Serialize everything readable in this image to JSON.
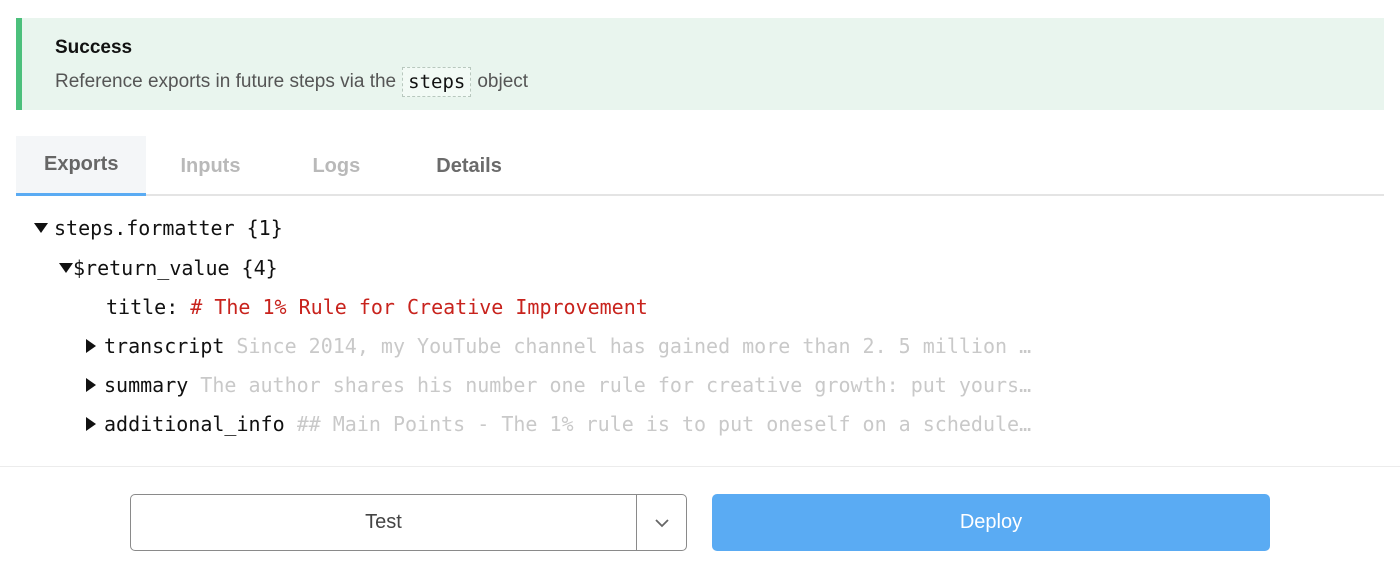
{
  "banner": {
    "title": "Success",
    "message_before": "Reference exports in future steps via the",
    "code": "steps",
    "message_after": "object",
    "accent_color": "#4cc07c",
    "background_color": "#e9f5ee"
  },
  "tabs": [
    {
      "label": "Exports",
      "active": true
    },
    {
      "label": "Inputs",
      "active": false
    },
    {
      "label": "Logs",
      "active": false
    },
    {
      "label": "Details",
      "active": false
    }
  ],
  "tree": {
    "root": {
      "key": "steps.formatter",
      "count": "{1}",
      "expanded": true
    },
    "return_value": {
      "key": "$return_value",
      "count": "{4}",
      "expanded": true
    },
    "items": [
      {
        "key": "title:",
        "value": "# The 1% Rule for Creative Improvement",
        "expandable": false
      },
      {
        "key": "transcript",
        "value": "Since 2014, my YouTube channel has gained more than 2. 5 million …",
        "expandable": true
      },
      {
        "key": "summary",
        "value": "The author shares his number one rule for creative growth: put yours…",
        "expandable": true
      },
      {
        "key": "additional_info",
        "value": "## Main Points - The 1% rule is to put oneself on a schedule…",
        "expandable": true
      }
    ]
  },
  "footer": {
    "test_label": "Test",
    "deploy_label": "Deploy",
    "deploy_color": "#5aabf3",
    "dropdown_icon": "chevron-down-icon"
  }
}
